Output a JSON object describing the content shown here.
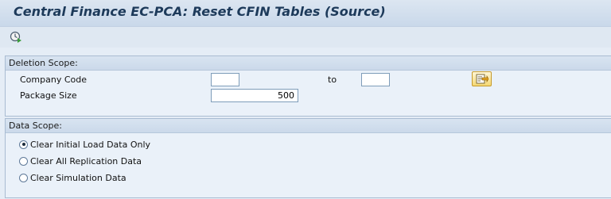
{
  "window": {
    "title": "Central Finance EC-PCA: Reset CFIN Tables (Source)"
  },
  "toolbar": {
    "execute_icon": "execute-clock-icon"
  },
  "deletion_scope": {
    "header": "Deletion Scope:",
    "company_code_label": "Company Code",
    "company_code_from": "",
    "to_label": "to",
    "company_code_to": "",
    "multiple_selection_icon": "multiple-selection-arrow-icon",
    "package_size_label": "Package Size",
    "package_size_value": "500"
  },
  "data_scope": {
    "header": "Data Scope:",
    "options": [
      {
        "label": "Clear Initial Load Data Only",
        "selected": true
      },
      {
        "label": "Clear All Replication Data",
        "selected": false
      },
      {
        "label": "Clear Simulation Data",
        "selected": false
      }
    ]
  },
  "colors": {
    "title_text": "#1d3a5a",
    "background": "#e5edf6",
    "group_header": "#cbd9ea"
  }
}
